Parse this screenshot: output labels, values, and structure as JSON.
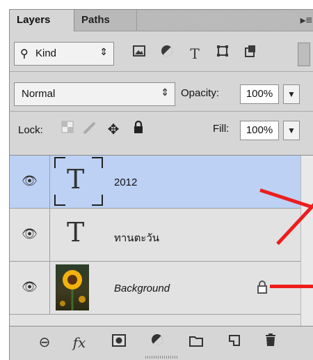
{
  "tabs": [
    {
      "label": "Layers",
      "active": true
    },
    {
      "label": "Paths",
      "active": false
    }
  ],
  "filter": {
    "kind_label": "Kind",
    "icons": [
      "pixel-layer-filter-icon",
      "adjustment-layer-filter-icon",
      "type-layer-filter-icon",
      "shape-layer-filter-icon",
      "smart-object-filter-icon"
    ]
  },
  "blend": {
    "mode": "Normal",
    "opacity_label": "Opacity:",
    "opacity_value": "100%",
    "fill_label": "Fill:",
    "fill_value": "100%"
  },
  "lock": {
    "label": "Lock:",
    "icons": [
      "lock-transparent-pixels-icon",
      "lock-image-pixels-icon",
      "lock-position-icon",
      "lock-all-icon"
    ]
  },
  "layers": [
    {
      "name": "2012",
      "type": "text",
      "selected": true,
      "visible": true
    },
    {
      "name": "ทานตะวัน",
      "type": "text",
      "selected": false,
      "visible": true
    },
    {
      "name": "Background",
      "type": "image",
      "selected": false,
      "visible": true,
      "locked": true
    }
  ],
  "bottom_icons": [
    "link-layers-icon",
    "fx-icon",
    "add-mask-icon",
    "adjustment-icon",
    "new-group-icon",
    "new-layer-icon",
    "delete-icon"
  ],
  "colors": {
    "selected_row": "#bcd1f3",
    "annotation": "#ee1d1d"
  }
}
